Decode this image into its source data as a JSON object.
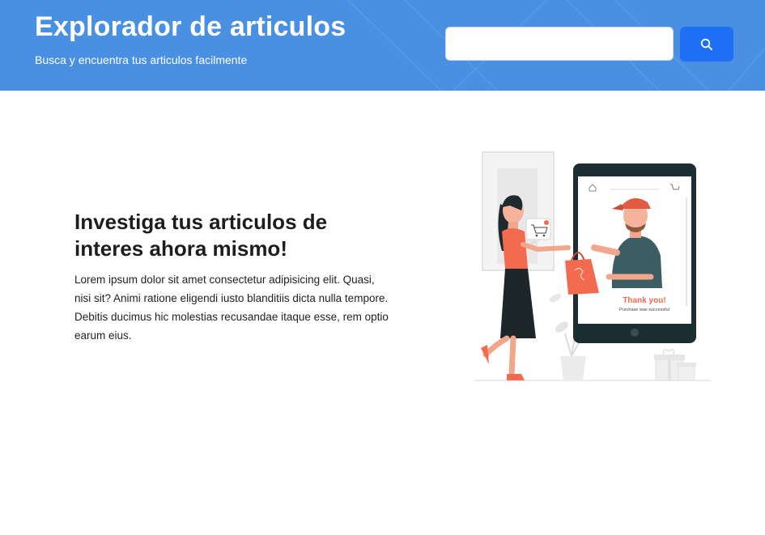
{
  "header": {
    "title": "Explorador de articulos",
    "subtitle": "Busca y encuentra tus articulos facilmente",
    "background_color": "#4a90e2"
  },
  "search": {
    "value": "",
    "placeholder": "",
    "button_icon": "search-icon",
    "button_color": "#1f6ff5"
  },
  "hero": {
    "title": "Investiga tus articulos de interes ahora mismo!",
    "description": "Lorem ipsum dolor sit amet consectetur adipisicing elit. Quasi, nisi sit? Animi ratione eligendi iusto blanditiis dicta nulla tempore. Debitis ducimus hic molestias recusandae itaque esse, rem optio earum eius."
  },
  "illustration": {
    "thank_you": "Thank you!",
    "purchase_text": "Purchase was successful",
    "accent_color": "#f26a4f"
  }
}
